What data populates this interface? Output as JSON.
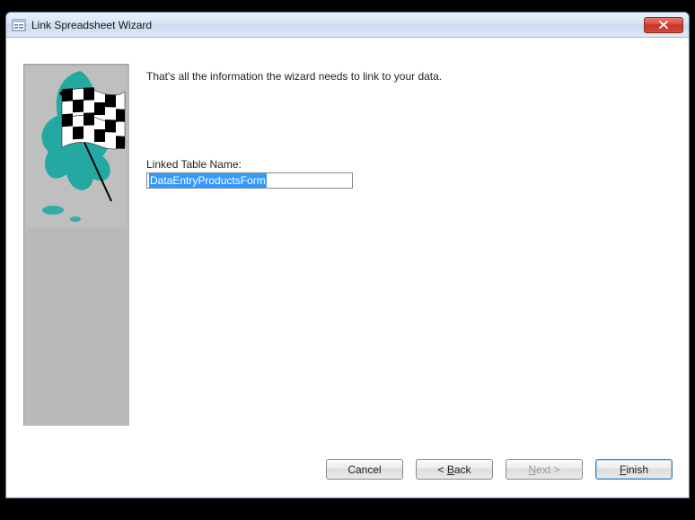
{
  "titlebar": {
    "title": "Link Spreadsheet Wizard"
  },
  "main": {
    "info_text": "That's all the information the wizard needs to link to your data.",
    "label": "Linked Table Name:",
    "input_value": "DataEntryProductsForm"
  },
  "buttons": {
    "cancel": "Cancel",
    "back_prefix": "< ",
    "back_u": "B",
    "back_rest": "ack",
    "next_u": "N",
    "next_rest": "ext >",
    "finish_u": "F",
    "finish_rest": "inish"
  }
}
